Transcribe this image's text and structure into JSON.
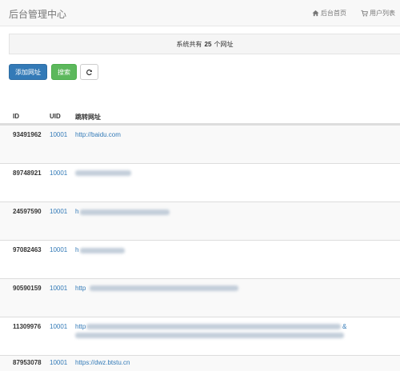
{
  "navbar": {
    "brand": "后台管理中心",
    "home_label": "后台首页",
    "users_label": "用户列表"
  },
  "info": {
    "prefix": "系统共有",
    "count": "25",
    "suffix": "个网址"
  },
  "toolbar": {
    "add_label": "添加网址",
    "search_label": "搜索",
    "refresh_icon": "refresh-icon"
  },
  "table": {
    "headers": [
      "ID",
      "UID",
      "跳转网址"
    ],
    "rows": [
      {
        "id": "93491962",
        "uid": "10001",
        "url": "http://baidu.com"
      },
      {
        "id": "89748921",
        "uid": "10001",
        "url": ""
      },
      {
        "id": "24597590",
        "uid": "10001",
        "url": "h"
      },
      {
        "id": "97082463",
        "uid": "10001",
        "url": "h"
      },
      {
        "id": "90590159",
        "uid": "10001",
        "url": "http"
      },
      {
        "id": "11309976",
        "uid": "10001",
        "url": "http",
        "url_tail": "&"
      },
      {
        "id": "87953078",
        "uid": "10001",
        "url": "https://dwz.btstu.cn"
      }
    ]
  }
}
